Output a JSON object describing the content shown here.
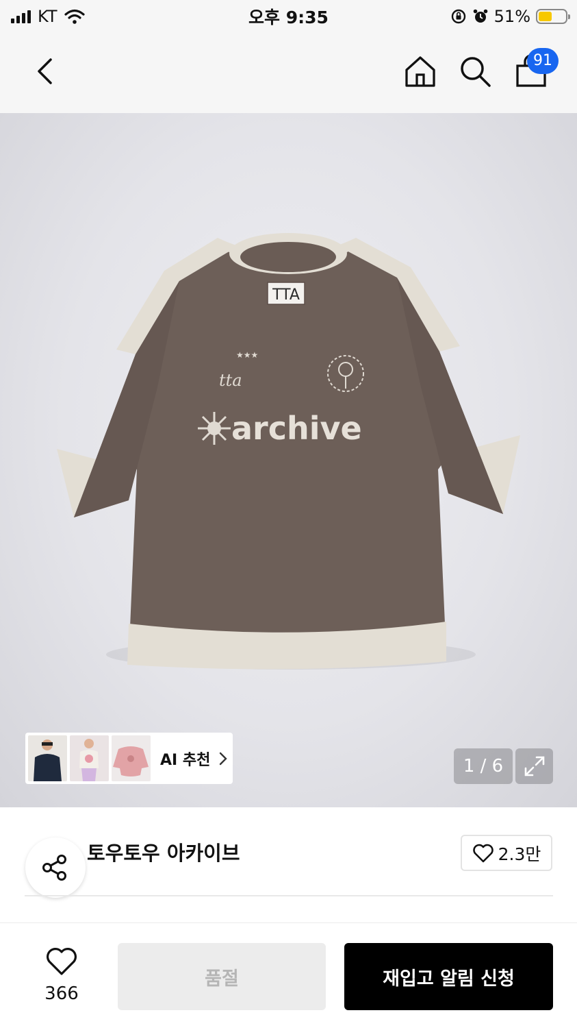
{
  "status_bar": {
    "carrier": "KT",
    "time": "오후 9:35",
    "battery": "51%",
    "battery_level": 0.51
  },
  "nav": {
    "cart_count": "91"
  },
  "gallery": {
    "shirt_tag": "TTA",
    "embroidery_text": "archive",
    "chest_script": "tta",
    "pager": "1 / 6",
    "ai_label": "AI 추천"
  },
  "product": {
    "brand": "토우토우 아카이브",
    "likes": "2.3만"
  },
  "bottom": {
    "wish_count": "366",
    "soldout_label": "품절",
    "restock_label": "재입고 알림 신청"
  },
  "colors": {
    "accent": "#1866f0",
    "shirt_body": "#6d5f58",
    "shirt_trim": "#e5e0d6",
    "battery_fill": "#f7c800"
  }
}
